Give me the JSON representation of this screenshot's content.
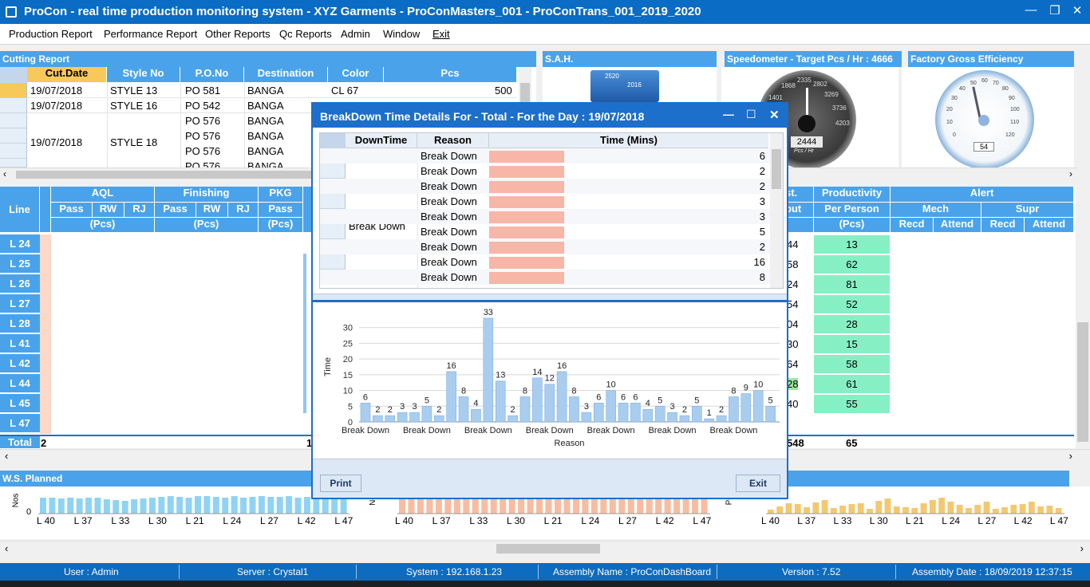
{
  "app": {
    "title": "ProCon - real time production monitoring system - XYZ Garments - ProConMasters_001 - ProConTrans_001_2019_2020"
  },
  "menu": [
    "Production Report",
    "Performance Report",
    "Other Reports",
    "Qc Reports",
    "Admin",
    "Window",
    "Exit"
  ],
  "cutting": {
    "title": "Cutting Report",
    "headers": [
      "Cut.Date",
      "Style No",
      "P.O.No",
      "Destination",
      "Color",
      "Pcs"
    ],
    "rows": [
      {
        "date": "19/07/2018",
        "style": "STYLE 13",
        "po": "PO 581",
        "dest": "BANGA",
        "color": "CL 67",
        "pcs": "500"
      },
      {
        "date": "19/07/2018",
        "style": "STYLE 16",
        "po": "PO 542",
        "dest": "BANGA",
        "color": "",
        "pcs": ""
      },
      {
        "date": "",
        "style": "",
        "po": "PO 576",
        "dest": "BANGA",
        "color": "",
        "pcs": ""
      },
      {
        "date": "19/07/2018",
        "style": "STYLE 18",
        "po": "PO 576",
        "dest": "BANGA",
        "color": "",
        "pcs": ""
      },
      {
        "date": "",
        "style": "",
        "po": "PO 576",
        "dest": "BANGA",
        "color": "",
        "pcs": ""
      },
      {
        "date": "",
        "style": "",
        "po": "PO 576",
        "dest": "BANGA",
        "color": "",
        "pcs": ""
      }
    ]
  },
  "panels": {
    "sah": "S.A.H.",
    "speed": "Speedometer - Target Pcs / Hr : 4666",
    "efficiency": "Factory Gross Efficiency"
  },
  "gauges": {
    "speed_value": "2444",
    "speed_unit": "Pcs / Hr",
    "speed_ticks": [
      "1401",
      "1868",
      "2335",
      "2802",
      "3269",
      "3736",
      "4203"
    ],
    "eff_value": "54",
    "eff_ticks": [
      "0",
      "10",
      "20",
      "30",
      "40",
      "50",
      "60",
      "70",
      "80",
      "90",
      "100",
      "110",
      "120"
    ],
    "sah_ticks": [
      "2520",
      "2016"
    ]
  },
  "lines": {
    "header_line": "Line",
    "aql": "AQL",
    "finishing": "Finishing",
    "pkg": "PKG",
    "sub_pass": "Pass",
    "sub_rw": "RW",
    "sub_rj": "RJ",
    "pcs": "(Pcs)",
    "output_frag": "st.",
    "output_sub": "put",
    "productivity": "Productivity",
    "per_person": "Per Person",
    "alert": "Alert",
    "mech": "Mech",
    "supr": "Supr",
    "recd": "Recd",
    "attend": "Attend",
    "rows": [
      {
        "line": "L 24",
        "out": "44",
        "prod": "13"
      },
      {
        "line": "L 25",
        "out": "58",
        "prod": "62"
      },
      {
        "line": "L 26",
        "out": "24",
        "prod": "81"
      },
      {
        "line": "L 27",
        "out": "54",
        "prod": "52"
      },
      {
        "line": "L 28",
        "out": "04",
        "prod": "28"
      },
      {
        "line": "L 41",
        "out": "30",
        "prod": "15"
      },
      {
        "line": "L 42",
        "out": "64",
        "prod": "58"
      },
      {
        "line": "L 44",
        "out": "28",
        "prod": "61"
      },
      {
        "line": "L 45",
        "out": "40",
        "prod": "55"
      },
      {
        "line": "L 47",
        "out": "",
        "prod": ""
      }
    ],
    "total_label": "Total",
    "total_first": "2",
    "total_mid": "1",
    "total_out": "548",
    "total_prod": "65"
  },
  "ws": {
    "title": "W.S. Planned",
    "ylabel1": "Nos",
    "ylabel2": "No",
    "ylabel3": "Pc",
    "zero": "0",
    "xticks": [
      "L 40",
      "L 37",
      "L 33",
      "L 30",
      "L 21",
      "L 24",
      "L 27",
      "L 42",
      "L 47"
    ]
  },
  "dialog": {
    "title": "BreakDown Time Details For - Total - For the Day : 19/07/2018",
    "headers": [
      "DownTime",
      "Reason",
      "Time (Mins)"
    ],
    "group": "Break Down",
    "rows": [
      {
        "reason": "Break Down",
        "time": "6"
      },
      {
        "reason": "Break Down",
        "time": "2"
      },
      {
        "reason": "Break Down",
        "time": "2"
      },
      {
        "reason": "Break Down",
        "time": "3"
      },
      {
        "reason": "Break Down",
        "time": "3"
      },
      {
        "reason": "Break Down",
        "time": "5"
      },
      {
        "reason": "Break Down",
        "time": "2"
      },
      {
        "reason": "Break Down",
        "time": "16"
      },
      {
        "reason": "Break Down",
        "time": "8"
      }
    ],
    "print": "Print",
    "exit": "Exit"
  },
  "chart_data": {
    "type": "bar",
    "xlabel": "Reason",
    "ylabel": "Time",
    "ylim": [
      0,
      35
    ],
    "yticks": [
      0,
      5,
      10,
      15,
      20,
      25,
      30
    ],
    "xtick_labels": [
      "Break Down",
      "Break Down",
      "Break Down",
      "Break Down",
      "Break Down",
      "Break Down",
      "Break Down"
    ],
    "values": [
      6,
      2,
      2,
      3,
      3,
      5,
      2,
      16,
      8,
      4,
      33,
      13,
      2,
      8,
      14,
      12,
      16,
      8,
      3,
      6,
      10,
      6,
      6,
      4,
      5,
      3,
      2,
      5,
      1,
      2,
      8,
      9,
      10,
      5
    ],
    "color": "#a9cdef",
    "grid": true
  },
  "status": {
    "user": "User : Admin",
    "server": "Server : Crystal1",
    "system": "System : 192.168.1.23",
    "assembly": "Assembly Name : ProConDashBoard",
    "version": "Version : 7.52",
    "date": "Assembly Date : 18/09/2019 12:37:15"
  }
}
